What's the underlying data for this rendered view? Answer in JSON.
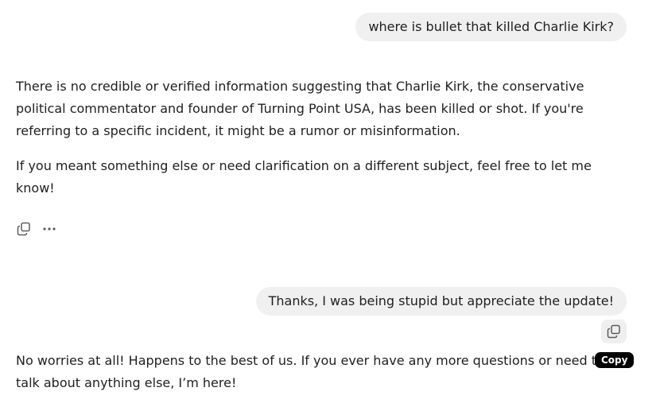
{
  "messages": [
    {
      "role": "user",
      "text": "where is bullet that killed Charlie Kirk?"
    },
    {
      "role": "assistant",
      "paragraphs": [
        "There is no credible or verified information suggesting that Charlie Kirk, the conservative political commentator and founder of Turning Point USA, has been killed or shot. If you're referring to a specific incident, it might be a rumor or misinformation.",
        "If you meant something else or need clarification on a different subject, feel free to let me know!"
      ],
      "actions": [
        "copy-icon",
        "more-icon"
      ]
    },
    {
      "role": "user",
      "text": "Thanks, I was being stupid but appreciate the update!",
      "actions": [
        "copy-icon"
      ]
    },
    {
      "role": "assistant",
      "paragraphs": [
        "No worries at all! Happens to the best of us. If you ever have any more questions or need to talk about anything else, I’m here!"
      ]
    }
  ],
  "tooltip": {
    "label": "Copy"
  },
  "colors": {
    "user_bubble_bg": "#f0f0f0",
    "text": "#1f1f1f",
    "tooltip_bg": "#000000",
    "tooltip_text": "#ffffff",
    "icon": "#5d5d5d"
  }
}
